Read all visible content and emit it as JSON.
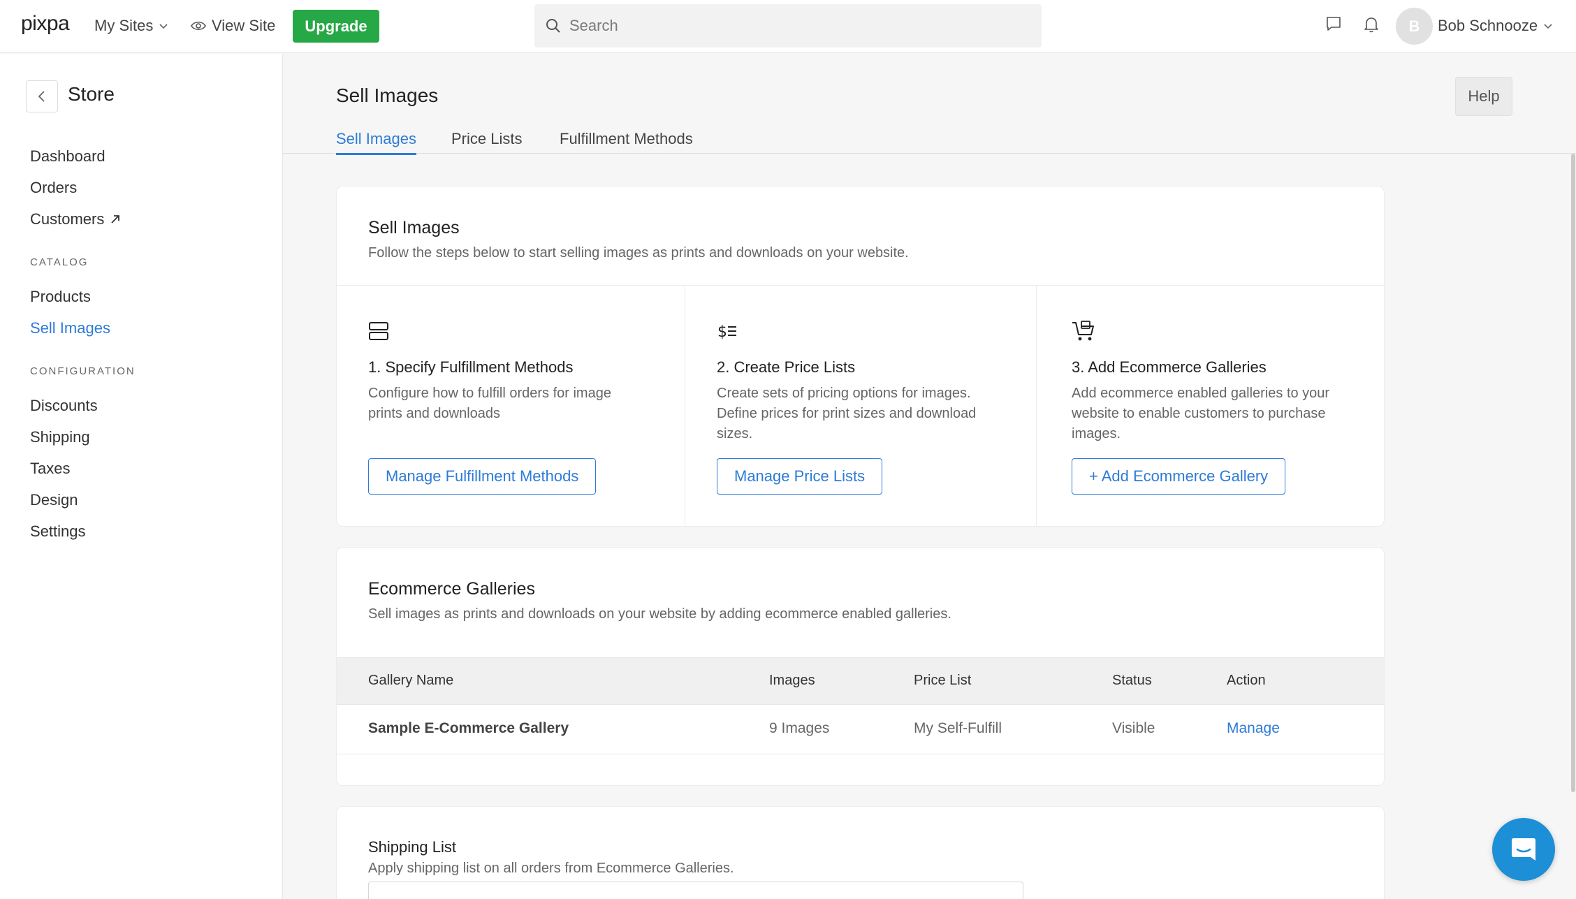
{
  "topbar": {
    "logo": "pixpa",
    "my_sites": "My Sites",
    "view_site": "View Site",
    "upgrade": "Upgrade",
    "search_placeholder": "Search",
    "user_initial": "B",
    "user_name": "Bob Schnooze"
  },
  "sidebar": {
    "title": "Store",
    "items_top": [
      "Dashboard",
      "Orders",
      "Customers"
    ],
    "section_catalog": "CATALOG",
    "items_catalog": [
      "Products",
      "Sell Images"
    ],
    "section_configuration": "CONFIGURATION",
    "items_configuration": [
      "Discounts",
      "Shipping",
      "Taxes",
      "Design",
      "Settings"
    ],
    "active_item": "Sell Images"
  },
  "main": {
    "title": "Sell Images",
    "help": "Help",
    "tabs": [
      "Sell Images",
      "Price Lists",
      "Fulfillment Methods"
    ],
    "active_tab": "Sell Images"
  },
  "sell_card": {
    "title": "Sell Images",
    "subtitle": "Follow the steps below to start selling images as prints and downloads on your website.",
    "steps": [
      {
        "icon": "server-icon",
        "title": "1. Specify Fulfillment Methods",
        "desc": "Configure how to fulfill orders for image prints and downloads",
        "button": "Manage Fulfillment Methods"
      },
      {
        "icon": "price-list-icon",
        "title": "2. Create Price Lists",
        "desc": "Create sets of pricing options for images. Define prices for print sizes and download sizes.",
        "button": "Manage Price Lists"
      },
      {
        "icon": "cart-gallery-icon",
        "title": "3. Add Ecommerce Galleries",
        "desc": "Add ecommerce enabled galleries to your website to enable customers to purchase images.",
        "button": "+ Add Ecommerce Gallery"
      }
    ]
  },
  "galleries_card": {
    "title": "Ecommerce Galleries",
    "subtitle": "Sell images as prints and downloads on your website by adding ecommerce enabled galleries.",
    "columns": [
      "Gallery Name",
      "Images",
      "Price List",
      "Status",
      "Action"
    ],
    "rows": [
      {
        "name": "Sample E-Commerce Gallery",
        "images": "9 Images",
        "price_list": "My Self-Fulfill",
        "status": "Visible",
        "action": "Manage"
      }
    ]
  },
  "shipping_card": {
    "title": "Shipping List",
    "subtitle": "Apply shipping list on all orders from Ecommerce Galleries."
  },
  "colors": {
    "accent": "#2e7bd6",
    "upgrade": "#27a846",
    "chat": "#1d8fd6"
  }
}
